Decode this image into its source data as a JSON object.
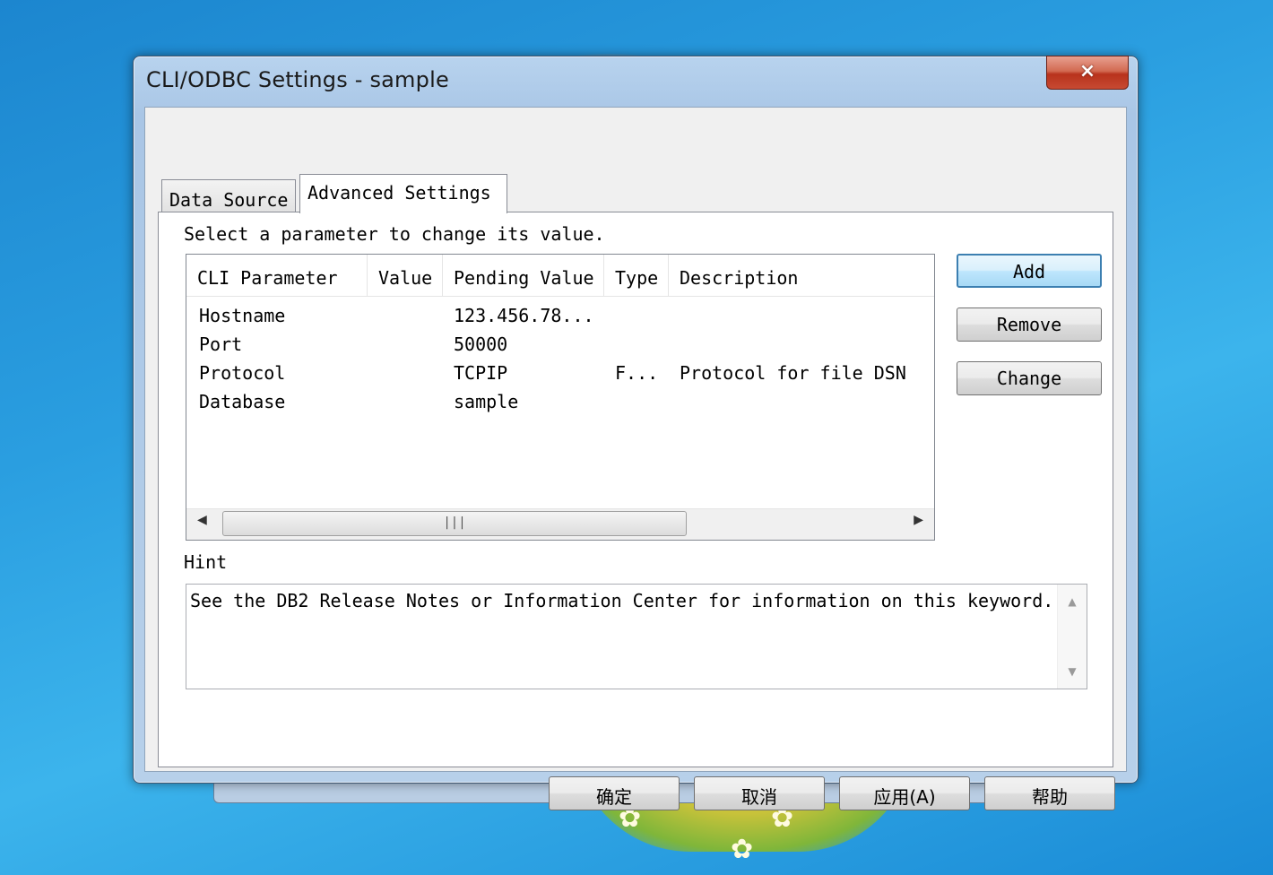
{
  "window": {
    "title": "CLI/ODBC Settings - sample",
    "close_icon": "×"
  },
  "tabs": [
    {
      "label": "Data Source",
      "selected": false
    },
    {
      "label": "Advanced Settings",
      "selected": true
    }
  ],
  "instruction": "Select a parameter to change its value.",
  "parameters_list": {
    "columns": [
      "CLI Parameter",
      "Value",
      "Pending Value",
      "Type",
      "Description"
    ],
    "rows": [
      {
        "parameter": "Hostname",
        "value": "",
        "pending": "123.456.78...",
        "type": "",
        "description": ""
      },
      {
        "parameter": "Port",
        "value": "",
        "pending": "50000",
        "type": "",
        "description": ""
      },
      {
        "parameter": "Protocol",
        "value": "",
        "pending": "TCPIP",
        "type": "F...",
        "description": "Protocol for file DSN"
      },
      {
        "parameter": "Database",
        "value": "",
        "pending": "sample",
        "type": "",
        "description": ""
      }
    ],
    "scroll_left_icon": "◀",
    "scroll_right_icon": "▶",
    "scroll_grip": "|||"
  },
  "side_buttons": {
    "add": "Add",
    "remove": "Remove",
    "change": "Change"
  },
  "hint": {
    "label": "Hint",
    "text": "See the DB2 Release Notes or Information Center for information on this keyword.",
    "scroll_up_icon": "▲",
    "scroll_down_icon": "▼"
  },
  "dialog_buttons": {
    "ok": "确定",
    "cancel": "取消",
    "apply": "应用(A)",
    "help": "帮助"
  },
  "colors": {
    "desktop": "#2a9ee0",
    "window_frame": "#b8d3ee",
    "close_button": "#c74a32",
    "default_button_border": "#3c7fb1"
  }
}
